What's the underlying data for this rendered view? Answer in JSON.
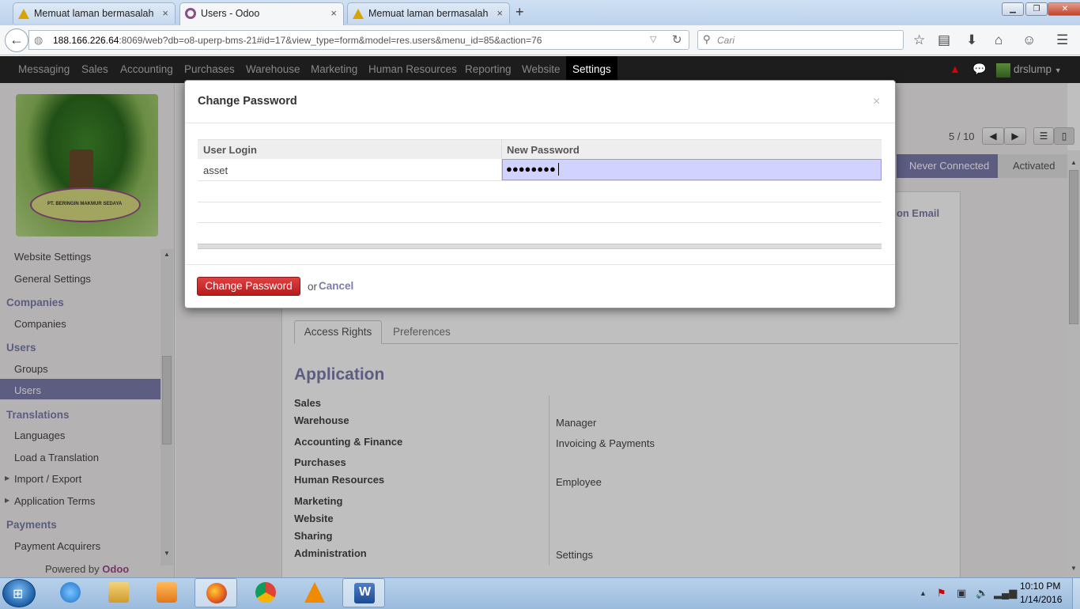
{
  "browser": {
    "tabs": [
      {
        "title": "Memuat laman bermasalah"
      },
      {
        "title": "Users - Odoo"
      },
      {
        "title": "Memuat laman bermasalah"
      }
    ],
    "url_host": "188.166.226.64",
    "url_rest": ":8069/web?db=o8-uperp-bms-21#id=17&view_type=form&model=res.users&menu_id=85&action=76",
    "search_placeholder": "Cari"
  },
  "topmenu": {
    "items": [
      "Messaging",
      "Sales",
      "Accounting",
      "Purchases",
      "Warehouse",
      "Marketing",
      "Human Resources",
      "Reporting",
      "Website",
      "Settings"
    ],
    "active": "Settings",
    "user": "drslump"
  },
  "sidebar": {
    "logo_text": "PT. BERINGIN MAKMUR SEDAYA",
    "items": [
      {
        "label": "Website Settings",
        "type": "item"
      },
      {
        "label": "General Settings",
        "type": "item"
      },
      {
        "label": "Companies",
        "type": "header"
      },
      {
        "label": "Companies",
        "type": "item"
      },
      {
        "label": "Users",
        "type": "header"
      },
      {
        "label": "Groups",
        "type": "item"
      },
      {
        "label": "Users",
        "type": "item"
      },
      {
        "label": "Translations",
        "type": "header"
      },
      {
        "label": "Languages",
        "type": "item"
      },
      {
        "label": "Load a Translation",
        "type": "item"
      },
      {
        "label": "Import / Export",
        "type": "item"
      },
      {
        "label": "Application Terms",
        "type": "item"
      },
      {
        "label": "Payments",
        "type": "header"
      },
      {
        "label": "Payment Acquirers",
        "type": "item"
      }
    ],
    "active": "Users",
    "powered_prefix": "Powered by",
    "powered_brand": "Odoo"
  },
  "form": {
    "pager": "5 / 10",
    "status": [
      "Never Connected",
      "Activated"
    ],
    "confirm_email_partial": "tion Email",
    "tabs": [
      "Access Rights",
      "Preferences"
    ],
    "section_title": "Application",
    "rows": [
      {
        "label": "Sales",
        "value": ""
      },
      {
        "label": "Warehouse",
        "value": "Manager"
      },
      {
        "label": "Accounting & Finance",
        "value": "Invoicing & Payments"
      },
      {
        "label": "Purchases",
        "value": ""
      },
      {
        "label": "Human Resources",
        "value": "Employee"
      },
      {
        "label": "Marketing",
        "value": ""
      },
      {
        "label": "Website",
        "value": ""
      },
      {
        "label": "Sharing",
        "value": ""
      },
      {
        "label": "Administration",
        "value": "Settings"
      }
    ]
  },
  "modal": {
    "title": "Change Password",
    "close": "×",
    "col_login": "User Login",
    "col_password": "New Password",
    "login_value": "asset",
    "password_masked": "●●●●●●●●",
    "submit_label": "Change Password",
    "or_text": "or",
    "cancel_label": "Cancel"
  },
  "taskbar": {
    "time": "10:10 PM",
    "date": "1/14/2016"
  },
  "colors": {
    "accent": "#7c7bad",
    "danger": "#c62828",
    "menubar": "#1d1d1d"
  }
}
